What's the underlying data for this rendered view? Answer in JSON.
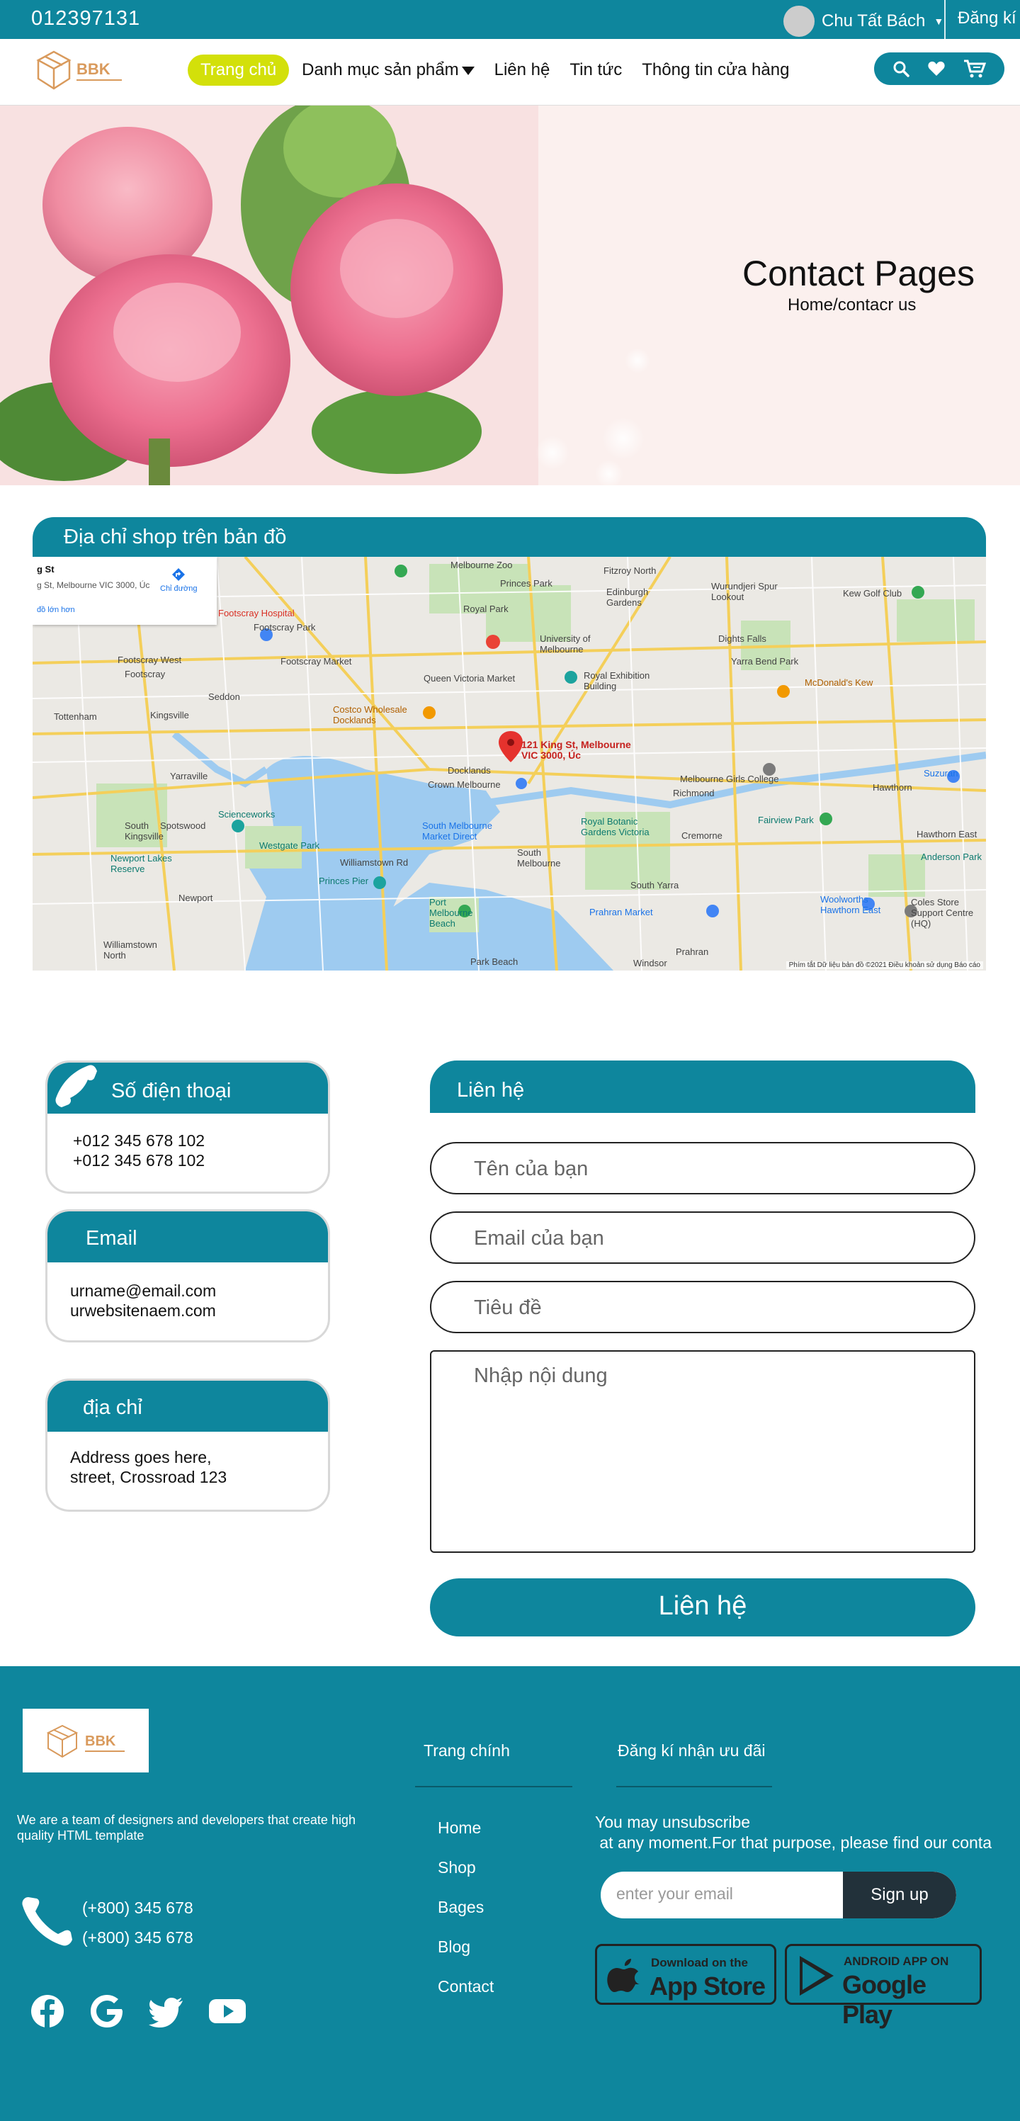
{
  "topbar": {
    "phone": "012397131",
    "user_name": "Chu Tất Bách",
    "register": "Đăng kí"
  },
  "nav": {
    "logo_text": "BBK",
    "items": [
      {
        "label": "Trang chủ"
      },
      {
        "label": "Danh mục sản phẩm"
      },
      {
        "label": "Liên hệ"
      },
      {
        "label": "Tin tức"
      },
      {
        "label": "Thông tin cửa hàng"
      }
    ]
  },
  "hero": {
    "title": "Contact Pages",
    "breadcrumb": "Home/contacr us"
  },
  "map_section": {
    "title": "Địa chỉ shop trên bản đồ",
    "card_title": "g St",
    "card_address": "g St, Melbourne VIC 3000, Úc",
    "card_link": "đồ lớn hơn",
    "card_directions": "Chỉ đường",
    "pin_label": "121 King St, Melbourne VIC 3000, Úc",
    "labels": [
      "Melbourne Zoo",
      "Princes Park",
      "Fitzroy North",
      "Edinburgh Gardens",
      "Wurundjeri Spur Lookout",
      "Kew Golf Club",
      "Footscray Hospital",
      "Footscray Park",
      "Royal Park",
      "University of Melbourne",
      "Royal Exhibition Building",
      "Footscray Market",
      "Queen Victoria Market",
      "Dights Falls",
      "Yarra Bend Park",
      "McDonald's Kew",
      "Costco Wholesale Docklands",
      "Tottenham",
      "Kingsville",
      "Seddon",
      "Yarraville",
      "Docklands",
      "Crown Melbourne",
      "Melbourne Girls College",
      "Hawthorn",
      "Suzuran",
      "Scienceworks",
      "Westgate Park",
      "South Melbourne Market Direct",
      "Royal Botanic Gardens Victoria",
      "Cremorne",
      "Richmond",
      "Fairview Park",
      "Hawthorn East",
      "Anderson Park",
      "Newport Lakes Reserve",
      "Newport",
      "Princes Pier",
      "Williamstown Rd",
      "South Yarra",
      "Woolworths Hawthorn East",
      "Coles Store Support Centre (HQ)",
      "Williamstown North",
      "Port Melbourne Beach",
      "Prahran Market",
      "Windsor",
      "Prahran",
      "Park Beach",
      "South Melbourne",
      "Spotswood",
      "South Kingsville",
      "Footscray West",
      "Footscray"
    ],
    "footer": "Phím tắt   Dữ liệu bản đồ ©2021   Điều khoản sử dụng   Báo cáo"
  },
  "cards": {
    "phone": {
      "title": "Số điện thoại",
      "lines": [
        "+012 345 678 102",
        "+012 345 678 102"
      ]
    },
    "email": {
      "title": "Email",
      "lines": [
        "urname@email.com",
        "urwebsitenaem.com"
      ]
    },
    "address": {
      "title": "địa chỉ",
      "lines": [
        "Address goes here,",
        "street, Crossroad 123"
      ]
    }
  },
  "form": {
    "title": "Liên hệ",
    "name_placeholder": "Tên của bạn",
    "email_placeholder": "Email của bạn",
    "subject_placeholder": "Tiêu đề",
    "message_placeholder": "Nhập nội dung",
    "submit": "Liên hệ"
  },
  "footer": {
    "logo_text": "BBK",
    "description": "We are a team of designers and developers that create high quality HTML template",
    "phones": [
      "(+800) 345 678",
      "(+800) 345 678"
    ],
    "col_main_title": "Trang chính",
    "links": [
      "Home",
      "Shop",
      "Bages",
      "Blog",
      "Contact"
    ],
    "col_sub_title": "Đăng kí nhận ưu đãi",
    "sub_text": "You may unsubscribe\n at any moment.For that purpose, please find our conta",
    "email_placeholder": "enter  your email",
    "signup": "Sign up",
    "appstore_small": "Download on the",
    "appstore_big": "App Store",
    "play_small": "ANDROID APP ON",
    "play_big": "Google Play"
  },
  "colors": {
    "primary": "#0e869d",
    "accent": "#d3e00a",
    "dark": "#22313a",
    "logo": "#d99a5c"
  }
}
